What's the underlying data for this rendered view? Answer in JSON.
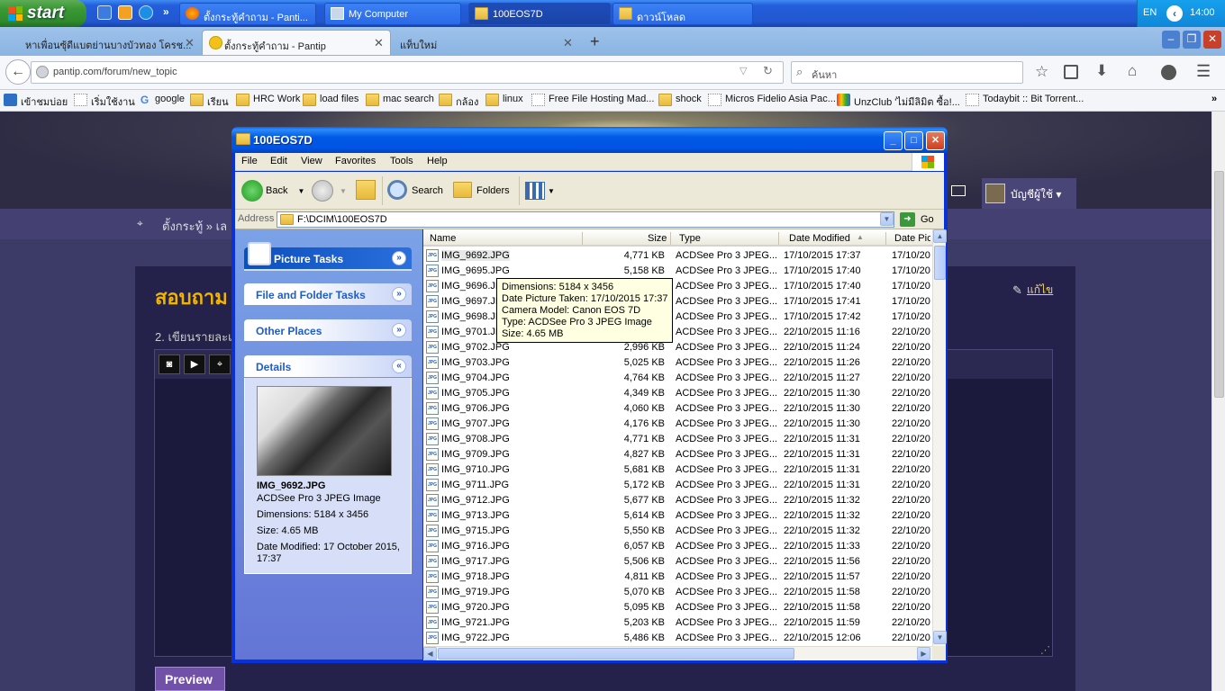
{
  "taskbar": {
    "start_label": "start",
    "tasks": [
      {
        "label": "ตั้งกระทู้คำถาม - Panti..."
      },
      {
        "label": "My Computer"
      },
      {
        "label": "100EOS7D"
      },
      {
        "label": "ดาวน์โหลด"
      }
    ],
    "lang": "EN",
    "clock": "14:00",
    "overflow": "»"
  },
  "browser": {
    "tabs": [
      {
        "label": "หาเพื่อนซุ้ดีแบตย่านบางบัวทอง โครช..."
      },
      {
        "label": "ตั้งกระทู้คำถาม - Pantip"
      },
      {
        "label": "แท็บใหม่"
      }
    ],
    "url": "pantip.com/forum/new_topic",
    "search_placeholder": "ค้นหา",
    "bookmarks": [
      {
        "label": "เข้าชมบ่อย"
      },
      {
        "label": "เริ่มใช้งาน"
      },
      {
        "label": "google"
      },
      {
        "label": "เรียน"
      },
      {
        "label": "HRC Work"
      },
      {
        "label": "load files"
      },
      {
        "label": "mac search"
      },
      {
        "label": "กล้อง"
      },
      {
        "label": "linux"
      },
      {
        "label": "Free File Hosting Mad..."
      },
      {
        "label": "shock"
      },
      {
        "label": "Micros Fidelio Asia Pac..."
      },
      {
        "label": "UnzClub 'ไม่มีลิมิต ซื้อ!..."
      },
      {
        "label": "Todaybit :: Bit Torrent..."
      }
    ],
    "bookmarks_more": "»"
  },
  "page": {
    "user_menu": "บัญชีผู้ใช้ ▾",
    "breadcrumb": "ตั้งกระทู้ » เล",
    "title_partial": "สอบถาม",
    "edit_link": "แก้ไข",
    "step_text": "2. เขียนรายละเ",
    "preview_button": "Preview"
  },
  "explorer": {
    "title": "100EOS7D",
    "menu": [
      "File",
      "Edit",
      "View",
      "Favorites",
      "Tools",
      "Help"
    ],
    "toolbar": {
      "back": "Back",
      "search": "Search",
      "folders": "Folders"
    },
    "address_label": "Address",
    "address": "F:\\DCIM\\100EOS7D",
    "go": "Go",
    "tasks": {
      "picture": "Picture Tasks",
      "file_folder": "File and Folder Tasks",
      "other": "Other Places",
      "details": "Details"
    },
    "details": {
      "name": "IMG_9692.JPG",
      "type": "ACDSee Pro 3 JPEG Image",
      "dimensions": "Dimensions: 5184 x 3456",
      "size": "Size: 4.65 MB",
      "modified": "Date Modified: 17 October 2015, 17:37"
    },
    "columns": {
      "name": "Name",
      "size": "Size",
      "type": "Type",
      "modified": "Date Modified",
      "picture": "Date Pict"
    },
    "tooltip": {
      "dimensions": "Dimensions: 5184 x 3456",
      "taken": "Date Picture Taken: 17/10/2015 17:37",
      "camera": "Camera Model: Canon EOS 7D",
      "type": "Type: ACDSee Pro 3 JPEG Image",
      "size": "Size: 4.65 MB"
    },
    "icon_text": "JPG",
    "files": [
      {
        "name": "IMG_9692.JPG",
        "size": "4,771 KB",
        "type": "ACDSee Pro 3 JPEG...",
        "modified": "17/10/2015 17:37",
        "picture": "17/10/20"
      },
      {
        "name": "IMG_9695.JPG",
        "size": "5,158 KB",
        "type": "ACDSee Pro 3 JPEG...",
        "modified": "17/10/2015 17:40",
        "picture": "17/10/20"
      },
      {
        "name": "IMG_9696.JPG",
        "size": "",
        "type": "ACDSee Pro 3 JPEG...",
        "modified": "17/10/2015 17:40",
        "picture": "17/10/20"
      },
      {
        "name": "IMG_9697.JPG",
        "size": "",
        "type": "ACDSee Pro 3 JPEG...",
        "modified": "17/10/2015 17:41",
        "picture": "17/10/20"
      },
      {
        "name": "IMG_9698.JPG",
        "size": "",
        "type": "ACDSee Pro 3 JPEG...",
        "modified": "17/10/2015 17:42",
        "picture": "17/10/20"
      },
      {
        "name": "IMG_9701.JPG",
        "size": "",
        "type": "ACDSee Pro 3 JPEG...",
        "modified": "22/10/2015 11:16",
        "picture": "22/10/20"
      },
      {
        "name": "IMG_9702.JPG",
        "size": "2,996 KB",
        "type": "ACDSee Pro 3 JPEG...",
        "modified": "22/10/2015 11:24",
        "picture": "22/10/20"
      },
      {
        "name": "IMG_9703.JPG",
        "size": "5,025 KB",
        "type": "ACDSee Pro 3 JPEG...",
        "modified": "22/10/2015 11:26",
        "picture": "22/10/20"
      },
      {
        "name": "IMG_9704.JPG",
        "size": "4,764 KB",
        "type": "ACDSee Pro 3 JPEG...",
        "modified": "22/10/2015 11:27",
        "picture": "22/10/20"
      },
      {
        "name": "IMG_9705.JPG",
        "size": "4,349 KB",
        "type": "ACDSee Pro 3 JPEG...",
        "modified": "22/10/2015 11:30",
        "picture": "22/10/20"
      },
      {
        "name": "IMG_9706.JPG",
        "size": "4,060 KB",
        "type": "ACDSee Pro 3 JPEG...",
        "modified": "22/10/2015 11:30",
        "picture": "22/10/20"
      },
      {
        "name": "IMG_9707.JPG",
        "size": "4,176 KB",
        "type": "ACDSee Pro 3 JPEG...",
        "modified": "22/10/2015 11:30",
        "picture": "22/10/20"
      },
      {
        "name": "IMG_9708.JPG",
        "size": "4,771 KB",
        "type": "ACDSee Pro 3 JPEG...",
        "modified": "22/10/2015 11:31",
        "picture": "22/10/20"
      },
      {
        "name": "IMG_9709.JPG",
        "size": "4,827 KB",
        "type": "ACDSee Pro 3 JPEG...",
        "modified": "22/10/2015 11:31",
        "picture": "22/10/20"
      },
      {
        "name": "IMG_9710.JPG",
        "size": "5,681 KB",
        "type": "ACDSee Pro 3 JPEG...",
        "modified": "22/10/2015 11:31",
        "picture": "22/10/20"
      },
      {
        "name": "IMG_9711.JPG",
        "size": "5,172 KB",
        "type": "ACDSee Pro 3 JPEG...",
        "modified": "22/10/2015 11:31",
        "picture": "22/10/20"
      },
      {
        "name": "IMG_9712.JPG",
        "size": "5,677 KB",
        "type": "ACDSee Pro 3 JPEG...",
        "modified": "22/10/2015 11:32",
        "picture": "22/10/20"
      },
      {
        "name": "IMG_9713.JPG",
        "size": "5,614 KB",
        "type": "ACDSee Pro 3 JPEG...",
        "modified": "22/10/2015 11:32",
        "picture": "22/10/20"
      },
      {
        "name": "IMG_9715.JPG",
        "size": "5,550 KB",
        "type": "ACDSee Pro 3 JPEG...",
        "modified": "22/10/2015 11:32",
        "picture": "22/10/20"
      },
      {
        "name": "IMG_9716.JPG",
        "size": "6,057 KB",
        "type": "ACDSee Pro 3 JPEG...",
        "modified": "22/10/2015 11:33",
        "picture": "22/10/20"
      },
      {
        "name": "IMG_9717.JPG",
        "size": "5,506 KB",
        "type": "ACDSee Pro 3 JPEG...",
        "modified": "22/10/2015 11:56",
        "picture": "22/10/20"
      },
      {
        "name": "IMG_9718.JPG",
        "size": "4,811 KB",
        "type": "ACDSee Pro 3 JPEG...",
        "modified": "22/10/2015 11:57",
        "picture": "22/10/20"
      },
      {
        "name": "IMG_9719.JPG",
        "size": "5,070 KB",
        "type": "ACDSee Pro 3 JPEG...",
        "modified": "22/10/2015 11:58",
        "picture": "22/10/20"
      },
      {
        "name": "IMG_9720.JPG",
        "size": "5,095 KB",
        "type": "ACDSee Pro 3 JPEG...",
        "modified": "22/10/2015 11:58",
        "picture": "22/10/20"
      },
      {
        "name": "IMG_9721.JPG",
        "size": "5,203 KB",
        "type": "ACDSee Pro 3 JPEG...",
        "modified": "22/10/2015 11:59",
        "picture": "22/10/20"
      },
      {
        "name": "IMG_9722.JPG",
        "size": "5,486 KB",
        "type": "ACDSee Pro 3 JPEG...",
        "modified": "22/10/2015 12:06",
        "picture": "22/10/20"
      }
    ]
  }
}
